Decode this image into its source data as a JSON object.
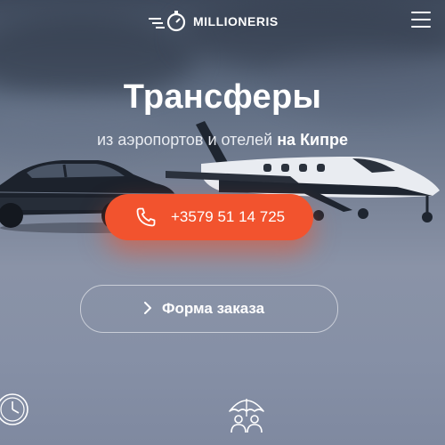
{
  "header": {
    "logo_text": "MILLIONERIS",
    "logo_icon": "stopwatch-logo-icon",
    "menu_icon": "hamburger-menu-icon"
  },
  "hero": {
    "title": "Трансферы",
    "subtitle_prefix": "из аэропортов и отелей ",
    "subtitle_highlight": "на Кипре"
  },
  "phone_button": {
    "icon": "phone-icon",
    "label": "+3579 51 14 725"
  },
  "order_button": {
    "icon": "chevron-right-icon",
    "label": "Форма заказа"
  },
  "features": [
    {
      "icon": "clock-icon"
    },
    {
      "icon": "umbrella-people-icon"
    }
  ],
  "colors": {
    "accent": "#f2532e",
    "sky_top": "#3f4a5c",
    "sky_bottom": "#8a93a7"
  }
}
